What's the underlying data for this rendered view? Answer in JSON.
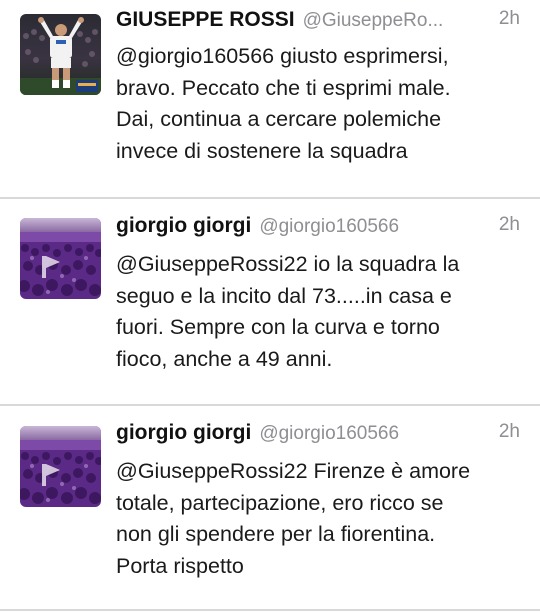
{
  "tweets": [
    {
      "name": "GIUSEPPE ROSSI",
      "handle": "@GiuseppeRo...",
      "time": "2h",
      "lines": [
        "@giorgio160566 giusto esprimersi,",
        "bravo. Peccato che ti esprimi male.",
        "Dai, continua a cercare polemiche",
        "invece di sostenere la squadra"
      ],
      "avatar_icon": "player-photo-avatar"
    },
    {
      "name": "giorgio giorgi",
      "handle": "@giorgio160566",
      "time": "2h",
      "lines": [
        "@GiuseppeRossi22 io la squadra la",
        "seguo e la incito dal 73.....in casa e",
        "fuori. Sempre con la curva e torno",
        "fioco, anche a 49 anni."
      ],
      "avatar_icon": "stadium-crowd-avatar"
    },
    {
      "name": "giorgio giorgi",
      "handle": "@giorgio160566",
      "time": "2h",
      "lines": [
        "@GiuseppeRossi22 Firenze è amore",
        "totale, partecipazione, ero ricco se",
        "non gli spendere per la fiorentina.",
        "Porta rispetto"
      ],
      "avatar_icon": "stadium-crowd-avatar"
    }
  ],
  "colors": {
    "name": "#111111",
    "meta": "#8e8e93",
    "text": "#1a1a1a",
    "divider": "#d9d9d9",
    "fiorentina_purple": "#5b2a86"
  }
}
